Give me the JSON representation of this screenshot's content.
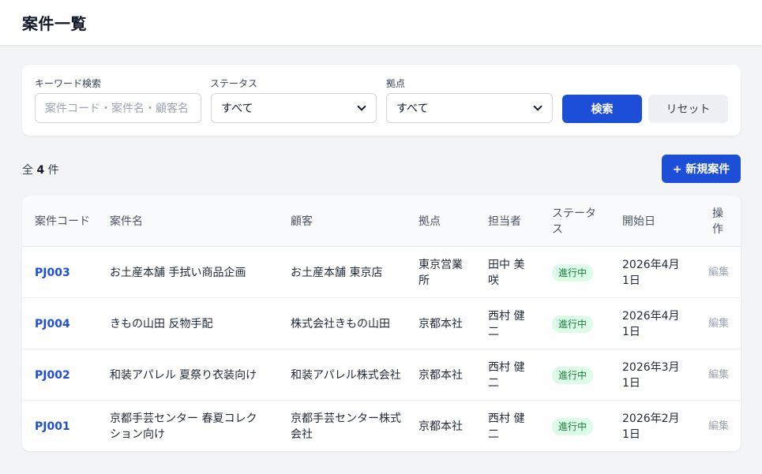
{
  "header": {
    "title": "案件一覧"
  },
  "filters": {
    "keyword_label": "キーワード検索",
    "keyword_placeholder": "案件コード・案件名・顧客名",
    "status_label": "ステータス",
    "status_value": "すべて",
    "office_label": "拠点",
    "office_value": "すべて",
    "search_button": "検索",
    "reset_button": "リセット"
  },
  "summary": {
    "prefix": "全",
    "count": "4",
    "suffix": "件"
  },
  "new_button": "+ 新規案件",
  "table": {
    "headers": [
      "案件コード",
      "案件名",
      "顧客",
      "拠点",
      "担当者",
      "ステータス",
      "開始日",
      "操作"
    ],
    "rows": [
      {
        "code": "PJ003",
        "name": "お土産本舗 手拭い商品企画",
        "customer": "お土産本舗 東京店",
        "office": "東京営業所",
        "owner": "田中 美咲",
        "status": "進行中",
        "start": "2026年4月1日",
        "action": "編集"
      },
      {
        "code": "PJ004",
        "name": "きもの山田 反物手配",
        "customer": "株式会社きもの山田",
        "office": "京都本社",
        "owner": "西村 健二",
        "status": "進行中",
        "start": "2026年4月1日",
        "action": "編集"
      },
      {
        "code": "PJ002",
        "name": "和装アパレル 夏祭り衣装向け",
        "customer": "和装アパレル株式会社",
        "office": "京都本社",
        "owner": "西村 健二",
        "status": "進行中",
        "start": "2026年3月1日",
        "action": "編集"
      },
      {
        "code": "PJ001",
        "name": "京都手芸センター 春夏コレクション向け",
        "customer": "京都手芸センター株式会社",
        "office": "京都本社",
        "owner": "西村 健二",
        "status": "進行中",
        "start": "2026年2月1日",
        "action": "編集"
      }
    ]
  },
  "colors": {
    "primary": "#1d4ed8",
    "status_bg": "#dcfce7",
    "status_text": "#15803d"
  }
}
